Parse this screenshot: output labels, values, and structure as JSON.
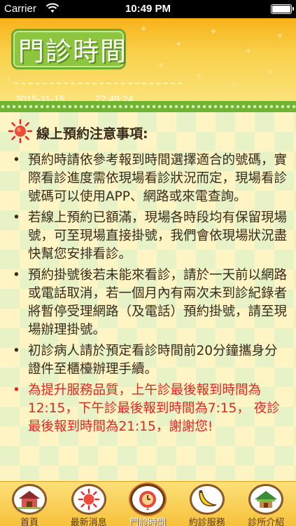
{
  "status_bar": {
    "carrier": "Carrier",
    "time": "10:49 PM"
  },
  "header": {
    "title": "門診時間",
    "date": "2015-11-15",
    "time": "22:49:24"
  },
  "notice": {
    "heading": "線上預約注意事項:",
    "bullet": "•",
    "items": [
      {
        "text": "預約時請依參考報到時間選擇適合的號碼，實際看診進度需依現場看診狀況而定，現場看診號碼可以使用APP、網路或來電查詢。",
        "color": "#3a2a1a"
      },
      {
        "text": "若線上預約已額滿，現場各時段均有保留現場號，可至現場直接掛號，我們會依現場狀況盡快幫您安排看診。",
        "color": "#3a2a1a"
      },
      {
        "text": "預約掛號後若未能來看診，請於一天前以網路或電話取消，若一個月內有兩次未到診紀錄者將暫停受理網路（及電話）預約掛號，請至現場辦理掛號。",
        "color": "#3a2a1a"
      },
      {
        "text": "初診病人請於預定看診時間前20分鐘攜身分證件至櫃檯辦理手續。",
        "color": "#3a2a1a"
      },
      {
        "text": "為提升服務品質，上午診最後報到時間為12:15，下午診最後報到時間為7:15， 夜診最後報到時間為21:15，謝謝您!",
        "color": "#e52521"
      }
    ]
  },
  "tabs": [
    {
      "label": "首頁",
      "icon": "house-icon",
      "active": false
    },
    {
      "label": "最新消息",
      "icon": "sun-icon",
      "active": false
    },
    {
      "label": "門診時間",
      "icon": "clock-icon",
      "active": true
    },
    {
      "label": "約診服務",
      "icon": "banana-icon",
      "active": false
    },
    {
      "label": "診所介紹",
      "icon": "hut-icon",
      "active": false
    }
  ],
  "colors": {
    "header_orange": "#f7b219",
    "title_green": "#8cc63f",
    "divider_green": "#6fb333",
    "alert_red": "#e52521"
  }
}
